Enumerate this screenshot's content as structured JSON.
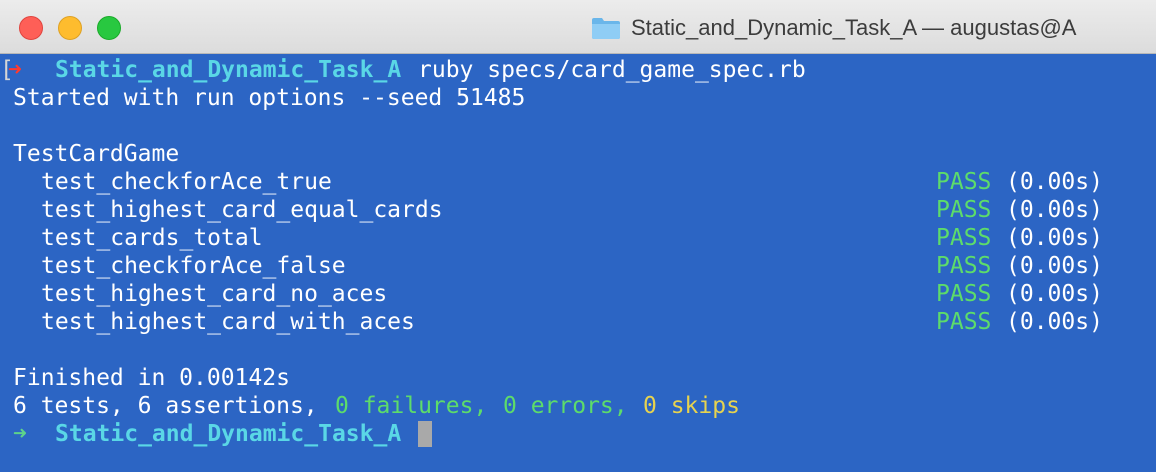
{
  "window": {
    "title": "Static_and_Dynamic_Task_A — augustas@A"
  },
  "icons": {
    "title_folder": "folder-icon",
    "prompt_arrow": "arrow-icon"
  },
  "colors": {
    "background": "#2c65c4",
    "text": "#ffffff",
    "directory": "#5ad7e6",
    "pass": "#5ddc6a",
    "skips": "#e7d34f",
    "prompt_error_arrow": "#ff3b2e",
    "prompt_ok_arrow": "#5dd38a"
  },
  "terminal": {
    "prompt1": {
      "bracket": "[",
      "arrow": "➜",
      "directory": "Static_and_Dynamic_Task_A",
      "command": "ruby specs/card_game_spec.rb"
    },
    "started": "Started with run options --seed 51485",
    "suite": "TestCardGame",
    "tests": [
      {
        "name": "test_checkforAce_true",
        "status": "PASS",
        "time": "(0.00s)"
      },
      {
        "name": "test_highest_card_equal_cards",
        "status": "PASS",
        "time": "(0.00s)"
      },
      {
        "name": "test_cards_total",
        "status": "PASS",
        "time": "(0.00s)"
      },
      {
        "name": "test_checkforAce_false",
        "status": "PASS",
        "time": "(0.00s)"
      },
      {
        "name": "test_highest_card_no_aces",
        "status": "PASS",
        "time": "(0.00s)"
      },
      {
        "name": "test_highest_card_with_aces",
        "status": "PASS",
        "time": "(0.00s)"
      }
    ],
    "finished": "Finished in 0.00142s",
    "summary": {
      "prefix": "6 tests, 6 assertions, ",
      "failures": "0 failures, ",
      "errors": "0 errors, ",
      "skips": "0 skips"
    },
    "prompt2": {
      "arrow": "➜",
      "directory": "Static_and_Dynamic_Task_A"
    }
  }
}
